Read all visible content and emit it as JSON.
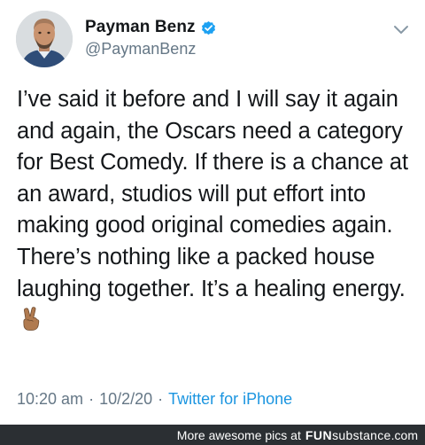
{
  "tweet": {
    "author": {
      "display_name": "Payman Benz",
      "handle": "@PaymanBenz",
      "verified": true,
      "avatar_icon": "profile-photo"
    },
    "text": "I’ve said it before and I will say it again and again, the Oscars need a category for Best Comedy. If there is a chance at an award, studios will put effort into making good original comedies again. There’s nothing like a packed house laughing together. It’s a healing energy.",
    "emoji": "victory-hand-emoji",
    "time": "10:20 am",
    "separator": "·",
    "date": "10/2/20",
    "source": "Twitter for iPhone"
  },
  "footer": {
    "caption": "More awesome pics at",
    "brand_bold": "FUN",
    "brand_rest": "substance",
    "brand_domain": ".com"
  },
  "colors": {
    "text": "#14171a",
    "secondary": "#657786",
    "link": "#1b95e0",
    "verified": "#1da1f2",
    "footer_bg": "#2b2f33"
  }
}
